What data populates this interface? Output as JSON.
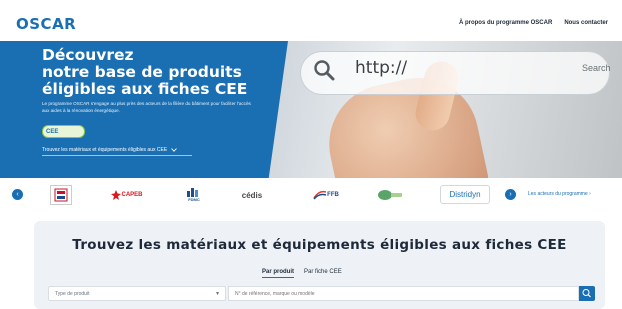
{
  "header": {
    "logo_text": "OSCAR",
    "logo_tagline": "",
    "nav": [
      {
        "label": "À propos du programme OSCAR"
      },
      {
        "label": "Nous contacter"
      }
    ]
  },
  "hero": {
    "title_line1": "Découvrez",
    "title_line2": "notre base de produits",
    "title_line3": "éligibles aux fiches CEE",
    "description": "Le programme OSCAR s'engage au plus près des acteurs de la filière du bâtiment pour faciliter l'accès aux aides à la rénovation énergétique.",
    "badge_label": "CEE",
    "badge_sub": "",
    "link_label": "Trouvez les matériaux et équipements éligibles aux CEE",
    "photo": {
      "url_text": "http://",
      "search_label": "Search"
    }
  },
  "partners": {
    "items": [
      {
        "label": "",
        "color": "#c8102e"
      },
      {
        "label": "CAPEB",
        "color": "#d71920"
      },
      {
        "label": "FDMC",
        "color": "#1f4e8c"
      },
      {
        "label": "cédis",
        "color": "#4a4a4a"
      },
      {
        "label": "FFB",
        "color": "#1a4d8f"
      },
      {
        "label": "",
        "color": "#5aa469"
      },
      {
        "label": "Distridyn",
        "color": "#1a6fb3"
      }
    ],
    "link_label": "Les acteurs du programme"
  },
  "finder": {
    "title": "Trouvez les matériaux et équipements éligibles aux fiches CEE",
    "tabs": [
      {
        "label": "Par produit",
        "active": true
      },
      {
        "label": "Par fiche CEE",
        "active": false
      }
    ],
    "select_value": "Type de produit",
    "input_placeholder": "N° de référence, marque ou modèle"
  },
  "colors": {
    "brand_blue": "#1a6fb3",
    "accent_green": "#8cc63f"
  }
}
